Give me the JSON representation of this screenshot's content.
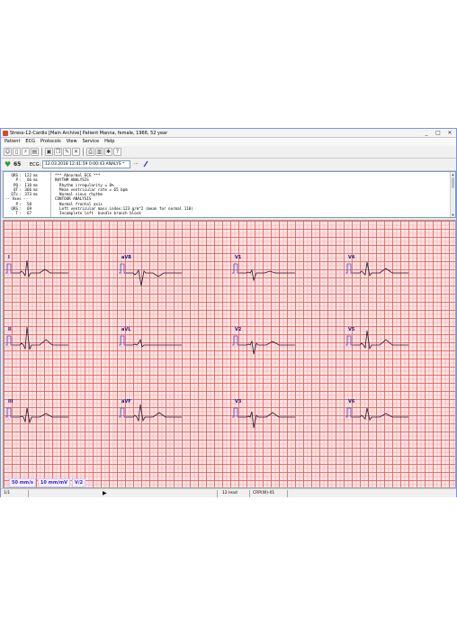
{
  "window": {
    "title": "Stress-12-Cardio [Main Archive] Patient Manna, female, 1966, 52 year",
    "controls": [
      "_",
      "□",
      "✕"
    ]
  },
  "menu": [
    "Patient",
    "ECG",
    "Protocols",
    "View",
    "Service",
    "Help"
  ],
  "ecg_bar": {
    "heart_rate": "65",
    "label": "ECG:",
    "selected_record": "12.03.2018 12:41:59 0:00:43 ANALYS *",
    "more": "···"
  },
  "measurements": [
    {
      "name": "QRS",
      "value": "122",
      "unit": "ms"
    },
    {
      "name": "P",
      "value": "66",
      "unit": "ms"
    },
    {
      "name": "PQ",
      "value": "110",
      "unit": "ms"
    },
    {
      "name": "QT",
      "value": "366",
      "unit": "ms"
    },
    {
      "name": "QTc",
      "value": "373",
      "unit": "ms"
    },
    {
      "name": "-- Axes --",
      "value": "",
      "unit": ""
    },
    {
      "name": "P",
      "value": "50",
      "unit": ""
    },
    {
      "name": "QRS",
      "value": "69",
      "unit": ""
    },
    {
      "name": "T",
      "value": "67",
      "unit": ""
    }
  ],
  "analysis": [
    "*** Abnormal ECG ***",
    "RHYTHM ANALYSIS",
    "  Rhythm irregularity = 0%",
    "  Mean ventricular rate = 65 bpm",
    "  Normal sinus rhythm",
    "CONTOUR ANALYSIS",
    "  Normal frontal axis",
    "  Left ventricular mass index:123 g/m^2 (mean for normal 110)",
    "  Incomplete left  bundle branch block"
  ],
  "leads": [
    {
      "label": "I"
    },
    {
      "label": "aVR"
    },
    {
      "label": "V1"
    },
    {
      "label": "V4"
    },
    {
      "label": "II"
    },
    {
      "label": "aVL"
    },
    {
      "label": "V2"
    },
    {
      "label": "V5"
    },
    {
      "label": "III"
    },
    {
      "label": "aVF"
    },
    {
      "label": "V3"
    },
    {
      "label": "V6"
    }
  ],
  "settings": {
    "speed": "50 mm/s",
    "gain": "10 mm/mV",
    "mode": "V/2"
  },
  "status": {
    "page": "1/1",
    "leads": "12 lead",
    "filter": "CRP(W)-01"
  },
  "colors": {
    "grid_major": "#e15a5a",
    "grid_bg": "#fde4e4",
    "label": "#1a1a80",
    "setting_text": "#2b2bd8"
  }
}
